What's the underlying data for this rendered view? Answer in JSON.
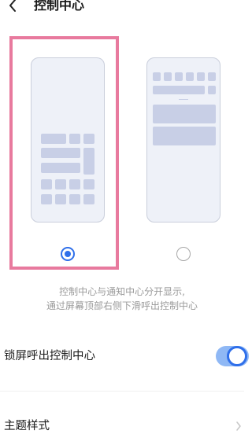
{
  "header": {
    "back_icon": "chevron-left-icon",
    "title": "控制中心"
  },
  "options": [
    {
      "name": "separate-style",
      "selected": true
    },
    {
      "name": "combined-style",
      "selected": false
    }
  ],
  "description": {
    "line1": "控制中心与通知中心分开显示,",
    "line2": "通过屏幕顶部右侧下滑呼出控制中心"
  },
  "settings": {
    "lock_screen": {
      "label": "锁屏呼出控制中心",
      "enabled": true
    },
    "theme_style": {
      "label": "主题样式"
    }
  },
  "colors": {
    "accent": "#2f6fea",
    "selection_highlight": "#e87a9e",
    "tile": "#c8cfe6",
    "phone_bg": "#eef1f8"
  }
}
